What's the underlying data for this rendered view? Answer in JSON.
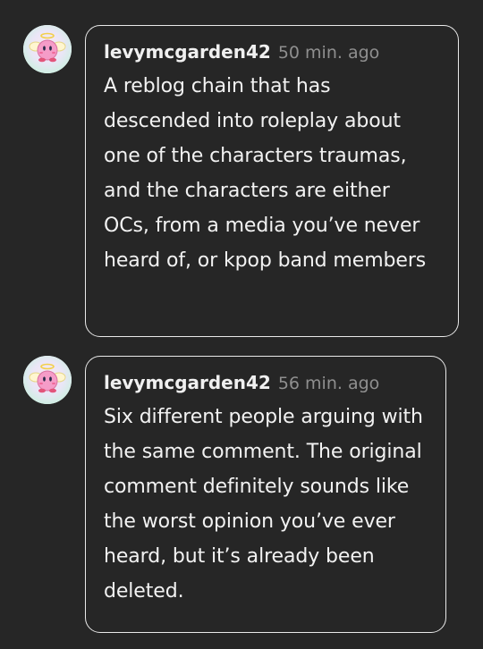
{
  "comments": [
    {
      "username": "levymcgarden42",
      "timestamp": "50 min. ago",
      "avatar_icon": "kirby-angel-icon",
      "text": "A reblog chain that has descended into roleplay about one of the characters traumas, and the characters are either OCs, from a media you’ve never heard of, or kpop band members"
    },
    {
      "username": "levymcgarden42",
      "timestamp": "56 min. ago",
      "avatar_icon": "kirby-angel-icon",
      "text": "Six different people arguing with the same comment. The original comment definitely sounds like the worst opinion you’ve ever heard, but it’s already been deleted."
    }
  ],
  "colors": {
    "background": "#262626",
    "border": "#e9e9e9",
    "text": "#f2f2f2",
    "timestamp": "#8f8f8f",
    "avatar_pink": "#f59cc8"
  }
}
